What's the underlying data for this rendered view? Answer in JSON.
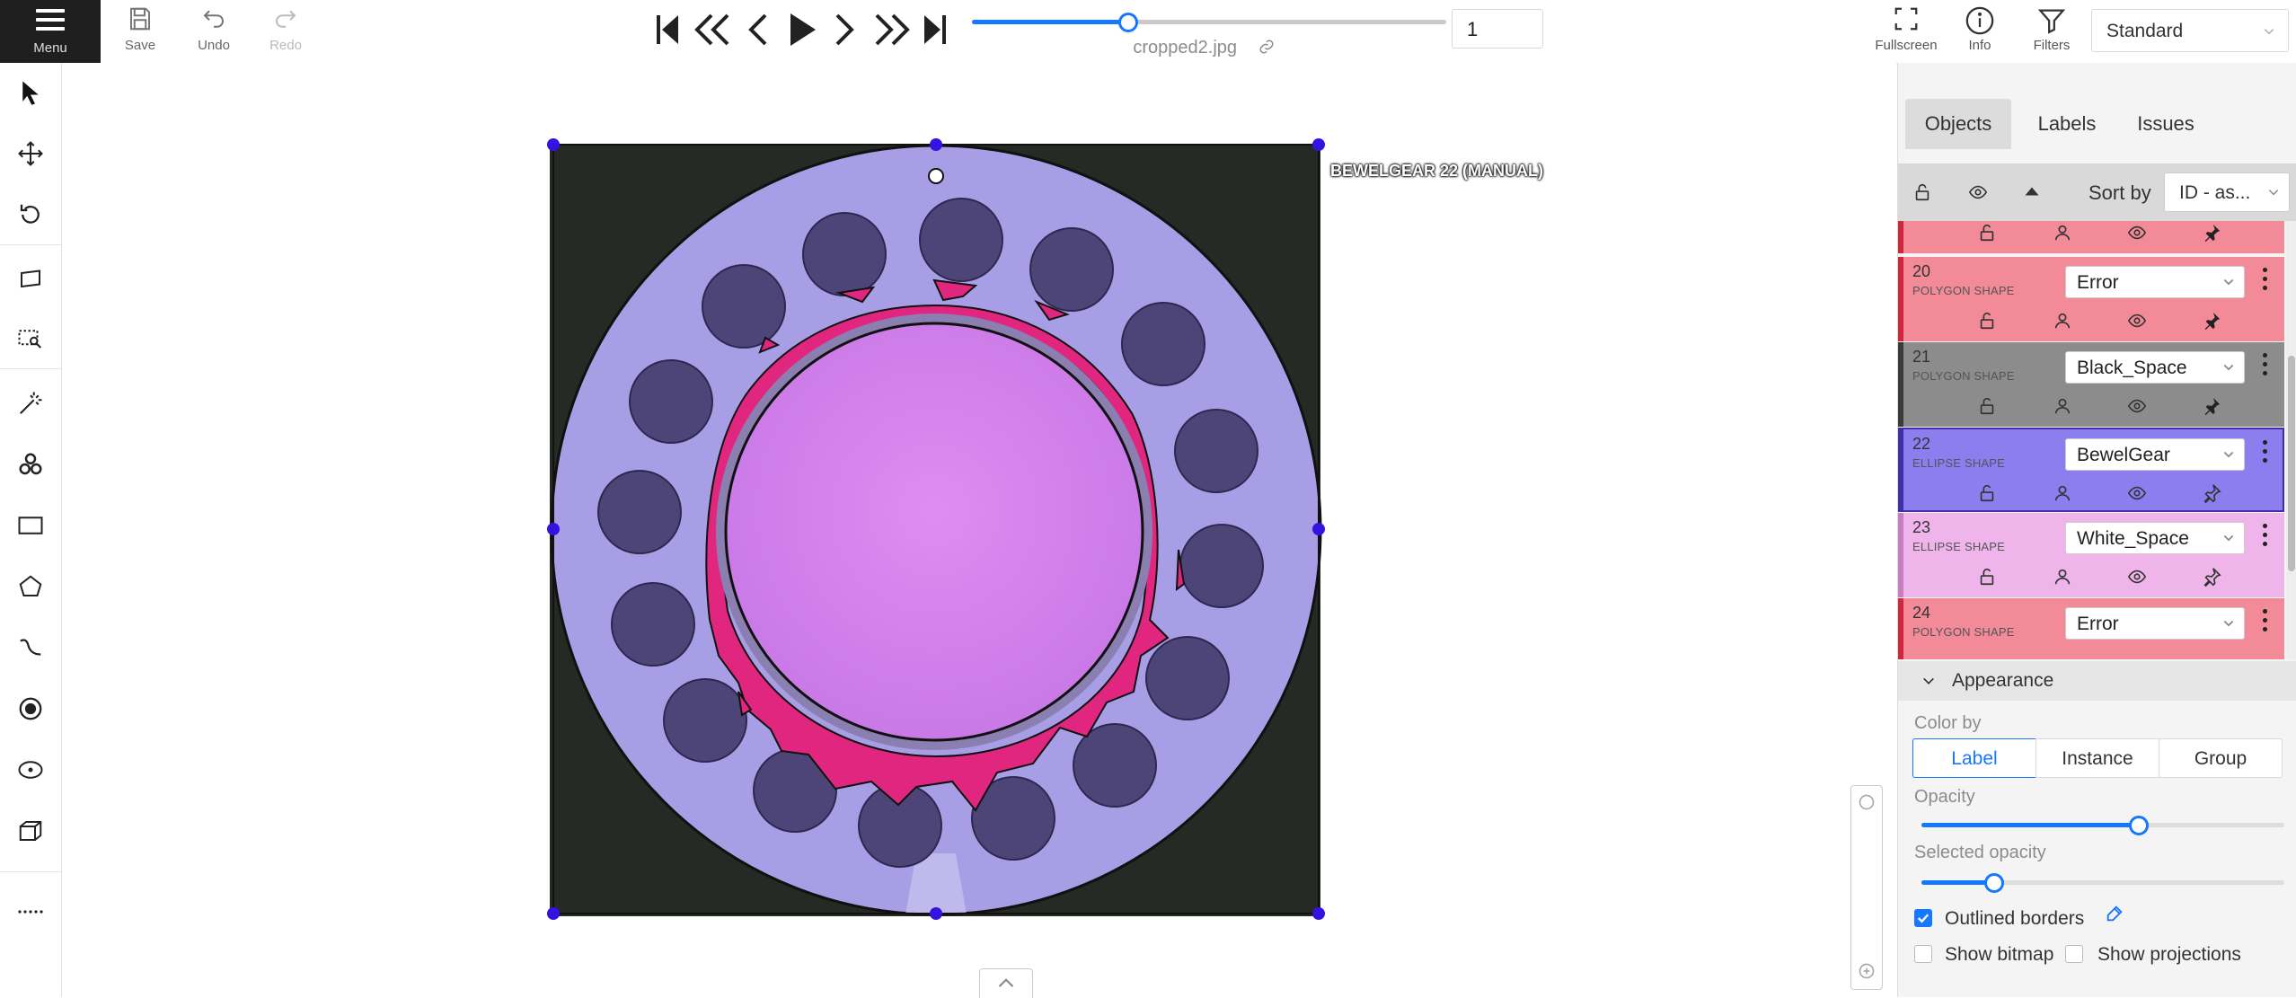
{
  "topbar": {
    "menu_label": "Menu",
    "save_label": "Save",
    "undo_label": "Undo",
    "redo_label": "Redo",
    "frame_number": "1",
    "frame_progress": 0.33,
    "filename": "cropped2.jpg",
    "fullscreen_label": "Fullscreen",
    "info_label": "Info",
    "filters_label": "Filters",
    "workspace": "Standard"
  },
  "canvas": {
    "object_label": "BEWELGEAR 22 (MANUAL)"
  },
  "sidebar": {
    "tabs": [
      "Objects",
      "Labels",
      "Issues"
    ],
    "sort_by_label": "Sort by",
    "sort_by_value": "ID - as...",
    "objects": [
      {
        "id": "20",
        "type": "POLYGON SHAPE",
        "label": "Error",
        "color": "#f28a97"
      },
      {
        "id": "21",
        "type": "POLYGON SHAPE",
        "label": "Black_Space",
        "color": "#8c8c8c"
      },
      {
        "id": "22",
        "type": "ELLIPSE SHAPE",
        "label": "BewelGear",
        "color": "#8d7ef0"
      },
      {
        "id": "23",
        "type": "ELLIPSE SHAPE",
        "label": "White_Space",
        "color": "#efb5ea"
      },
      {
        "id": "24",
        "type": "POLYGON SHAPE",
        "label": "Error",
        "color": "#f28a97"
      }
    ],
    "appearance": {
      "title": "Appearance",
      "color_by_label": "Color by",
      "color_by_options": [
        "Label",
        "Instance",
        "Group"
      ],
      "color_by_selected": "Label",
      "opacity_label": "Opacity",
      "opacity_value": 0.6,
      "selected_opacity_label": "Selected opacity",
      "selected_opacity_value": 0.2,
      "outlined_borders_label": "Outlined borders",
      "outlined_borders_checked": true,
      "show_bitmap_label": "Show bitmap",
      "show_projections_label": "Show projections"
    }
  }
}
